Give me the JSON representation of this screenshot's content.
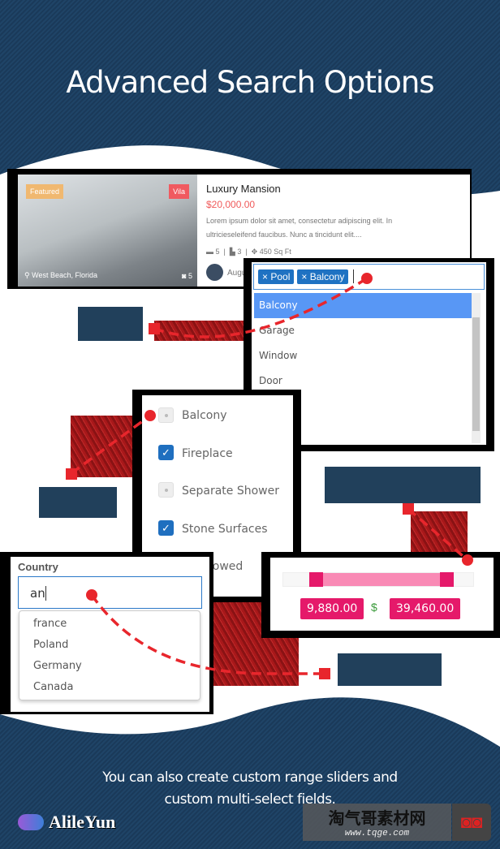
{
  "title": "Advanced Search Options",
  "card": {
    "featured": "Featured",
    "type": "Vila",
    "name": "Luxury Mansion",
    "price": "$20,000.00",
    "desc": "Lorem ipsum dolor sit amet, consectetur adipiscing elit. In ultricieseleifend faucibus. Nunc a tincidunt elit....",
    "beds": "5",
    "baths": "3",
    "area": "450 Sq Ft",
    "location": "West Beach, Florida",
    "photos": "5",
    "agent": "Augus"
  },
  "multiselect": {
    "tags": [
      "Pool",
      "Balcony"
    ],
    "options": [
      "Balcony",
      "Garage",
      "Window",
      "Door"
    ],
    "highlighted": "Balcony"
  },
  "checkboxes": [
    {
      "label": "Balcony",
      "checked": false
    },
    {
      "label": "Fireplace",
      "checked": true
    },
    {
      "label": "Separate Shower",
      "checked": false
    },
    {
      "label": "Stone Surfaces",
      "checked": true
    },
    {
      "label": "llowed",
      "checked": false
    }
  ],
  "country": {
    "label": "Country",
    "value": "an",
    "options": [
      "france",
      "Poland",
      "Germany",
      "Canada"
    ]
  },
  "range": {
    "min": "9,880.00",
    "max": "39,460.00",
    "currency": "$",
    "low_fraction": 0.17,
    "high_fraction": 0.86
  },
  "footer": [
    "You can also create custom range sliders and",
    "custom multi-select fields."
  ],
  "logo": "AlileYun",
  "watermark": {
    "text": "淘气哥素材网",
    "url": "www.tqge.com"
  },
  "colors": {
    "accent": "#e5196a",
    "tag": "#1f72c2",
    "price": "#f05a5a",
    "navy": "#21405b"
  }
}
